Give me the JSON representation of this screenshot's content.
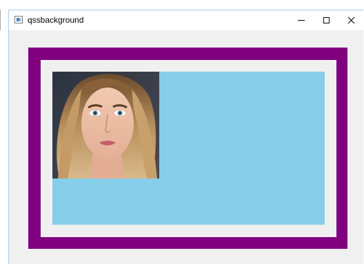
{
  "window": {
    "title": "qssbackground",
    "icon": "app-window-icon",
    "controls": {
      "minimize_icon": "minimize-icon",
      "maximize_icon": "maximize-icon",
      "close_icon": "close-icon"
    }
  },
  "content": {
    "frame_color": "#800080",
    "inner_border_color": "#f0f0f0",
    "background_color": "#87ceeb",
    "image": "portrait-photo"
  }
}
